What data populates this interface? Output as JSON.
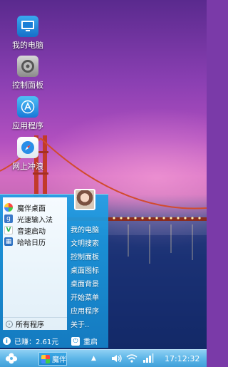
{
  "desktop_icons": [
    {
      "label": "我的电脑",
      "icon": "computer-icon"
    },
    {
      "label": "控制面板",
      "icon": "settings-icon"
    },
    {
      "label": "应用程序",
      "icon": "app-store-icon"
    },
    {
      "label": "网上冲浪",
      "icon": "compass-icon"
    }
  ],
  "start_menu": {
    "programs": [
      {
        "label": "魔伴桌面",
        "icon": "flower-icon"
      },
      {
        "label": "光速输入法",
        "icon": "keyboard-g-icon"
      },
      {
        "label": "音速启动",
        "icon": "v-icon"
      },
      {
        "label": "哈哈日历",
        "icon": "calendar-icon"
      }
    ],
    "all_programs": "所有程序",
    "right_items": [
      "我的电脑",
      "文明搜索",
      "控制面板",
      "桌面图标",
      "桌面背景",
      "开始菜单",
      "应用程序",
      "关于.."
    ],
    "earnings": "已赚：2.61元",
    "restart": "重启"
  },
  "taskbar": {
    "app_label": "魔伴",
    "clock": "17:12:32"
  },
  "colors": {
    "menu_blue": "#1a9ee0",
    "taskbar_blue": "#5eb6e8"
  }
}
